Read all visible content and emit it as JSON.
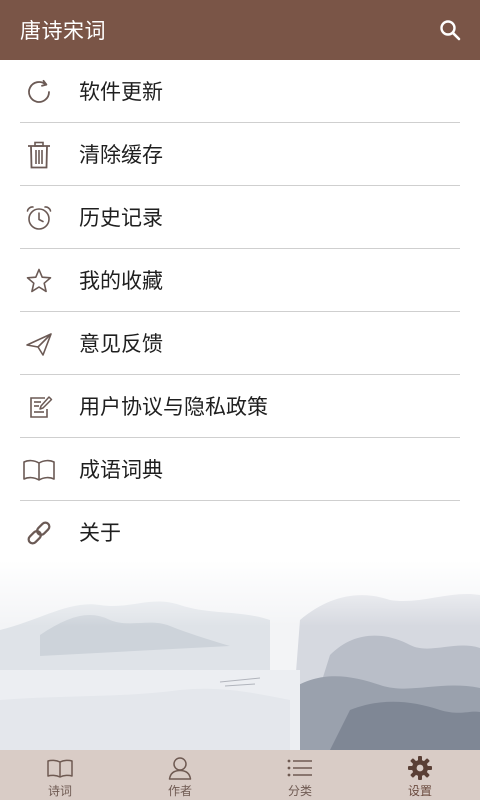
{
  "header": {
    "title": "唐诗宋词",
    "search_icon": "search-icon"
  },
  "menu": {
    "items": [
      {
        "label": "软件更新",
        "icon": "refresh-icon"
      },
      {
        "label": "清除缓存",
        "icon": "trash-icon"
      },
      {
        "label": "历史记录",
        "icon": "alarm-clock-icon"
      },
      {
        "label": "我的收藏",
        "icon": "star-icon"
      },
      {
        "label": "意见反馈",
        "icon": "paper-plane-icon"
      },
      {
        "label": "用户协议与隐私政策",
        "icon": "document-edit-icon"
      },
      {
        "label": "成语词典",
        "icon": "open-book-icon"
      },
      {
        "label": "关于",
        "icon": "link-icon"
      }
    ]
  },
  "tabs": [
    {
      "label": "诗词",
      "icon": "book-icon",
      "active": false
    },
    {
      "label": "作者",
      "icon": "person-icon",
      "active": false
    },
    {
      "label": "分类",
      "icon": "list-icon",
      "active": false
    },
    {
      "label": "设置",
      "icon": "gear-icon",
      "active": true
    }
  ],
  "colors": {
    "header_bg": "#7a5547",
    "tabbar_bg": "#d9ccc6",
    "icon_stroke": "#6b5a55",
    "divider": "#cfcfcf"
  }
}
